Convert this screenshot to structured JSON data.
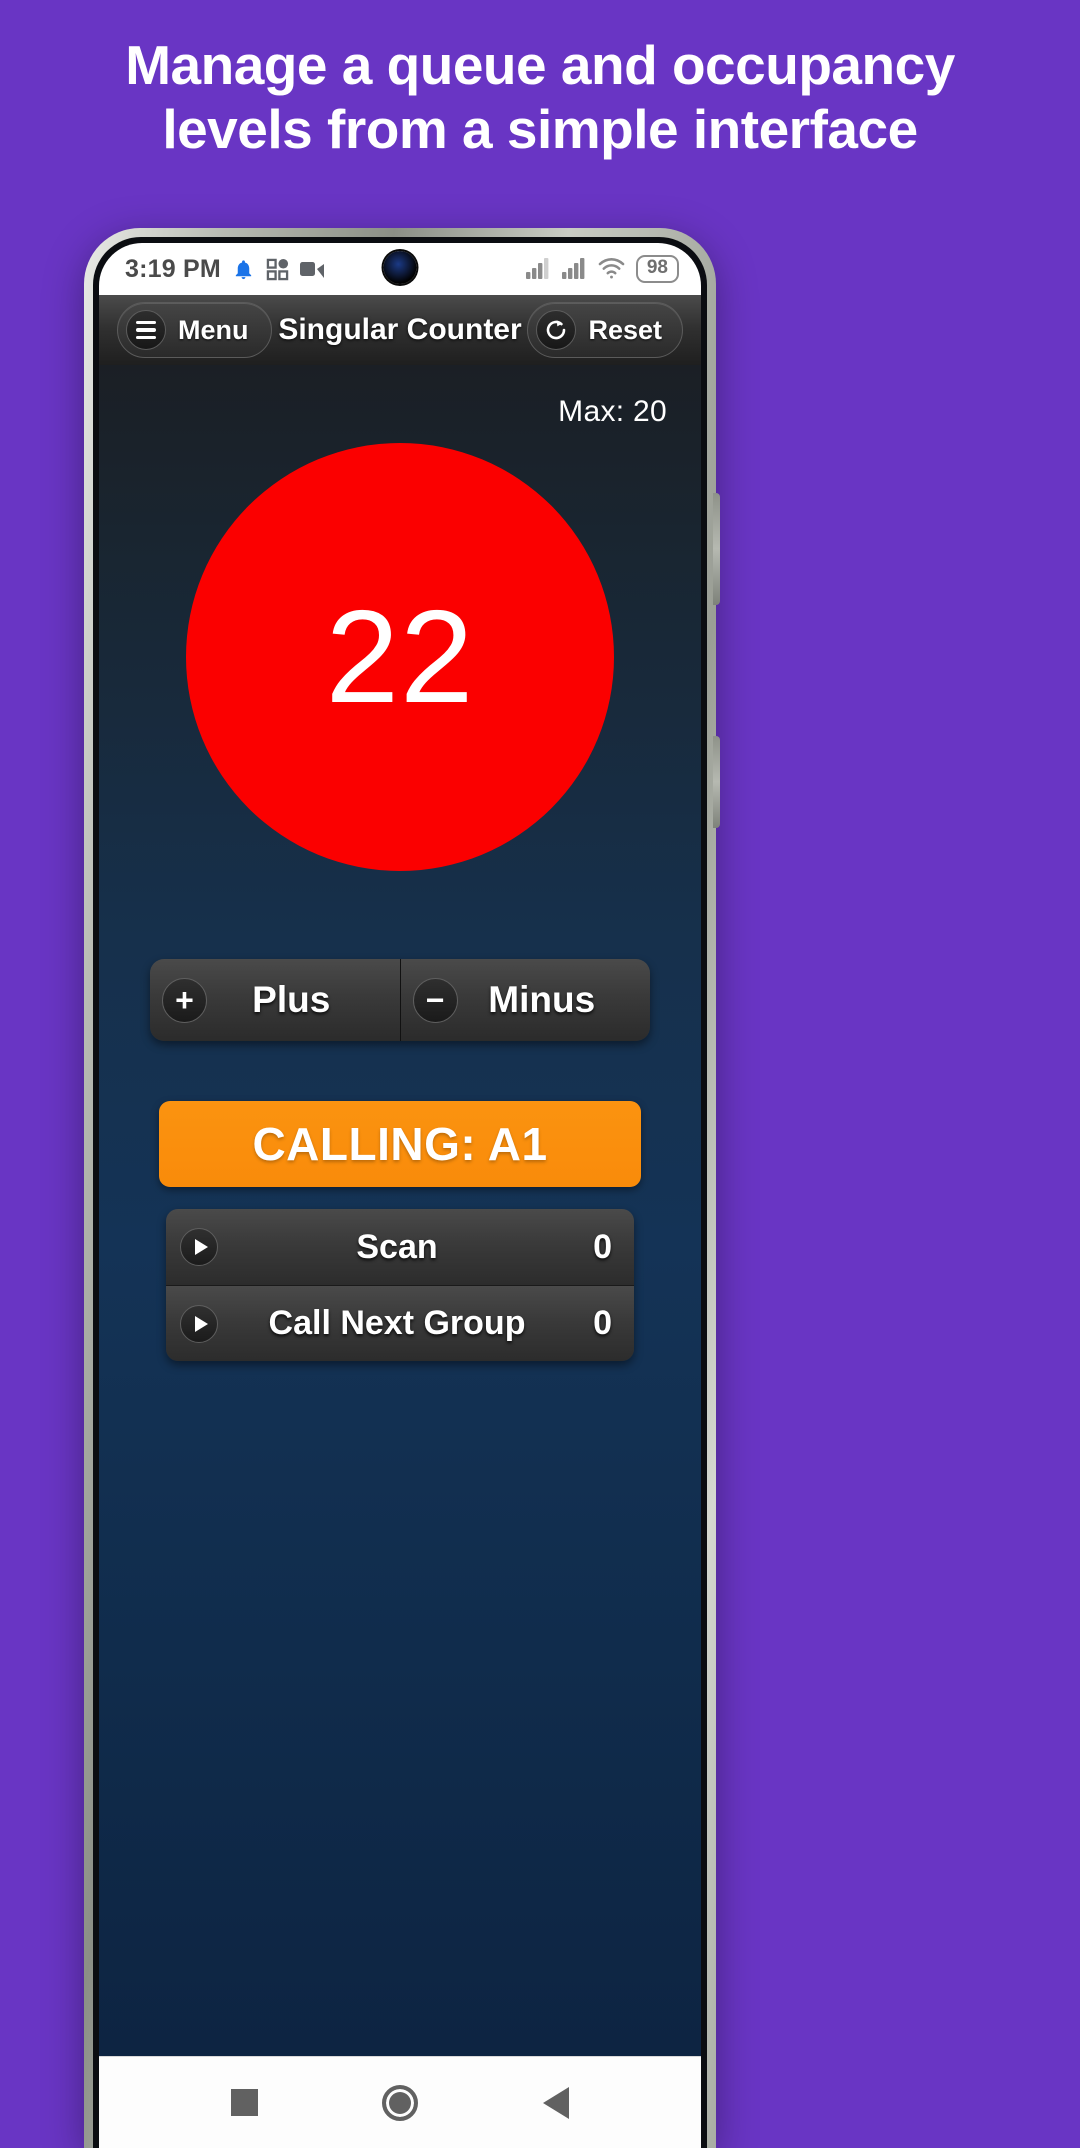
{
  "promo": {
    "headline_line1": "Manage a queue and occupancy",
    "headline_line2": "levels from a simple interface",
    "background_color": "#6935c4",
    "text_color": "#ffffff"
  },
  "status_bar": {
    "time": "3:19 PM",
    "icons": [
      "bell-icon",
      "apps-grid-icon",
      "video-camera-icon"
    ],
    "signal_bars_1": "signal-icon",
    "signal_bars_2": "signal-icon",
    "wifi": "wifi-icon",
    "battery_level": "98"
  },
  "app_bar": {
    "menu_label": "Menu",
    "menu_icon": "hamburger-icon",
    "title": "Singular Counter",
    "reset_label": "Reset",
    "reset_icon": "refresh-icon"
  },
  "counter": {
    "max_label": "Max: 20",
    "value": "22",
    "circle_color": "#fb0000",
    "value_color": "#ffffff"
  },
  "controls": {
    "plus_label": "Plus",
    "plus_icon": "plus-circle-icon",
    "plus_glyph": "+",
    "minus_label": "Minus",
    "minus_icon": "minus-circle-icon",
    "minus_glyph": "−"
  },
  "calling": {
    "text": "CALLING: A1",
    "color": "#f98b0a"
  },
  "actions": [
    {
      "icon": "play-icon",
      "label": "Scan",
      "count": "0"
    },
    {
      "icon": "play-icon",
      "label": "Call Next Group",
      "count": "0"
    }
  ],
  "nav_bar": {
    "recents": "square-icon",
    "home": "circle-icon",
    "back": "triangle-back-icon"
  }
}
